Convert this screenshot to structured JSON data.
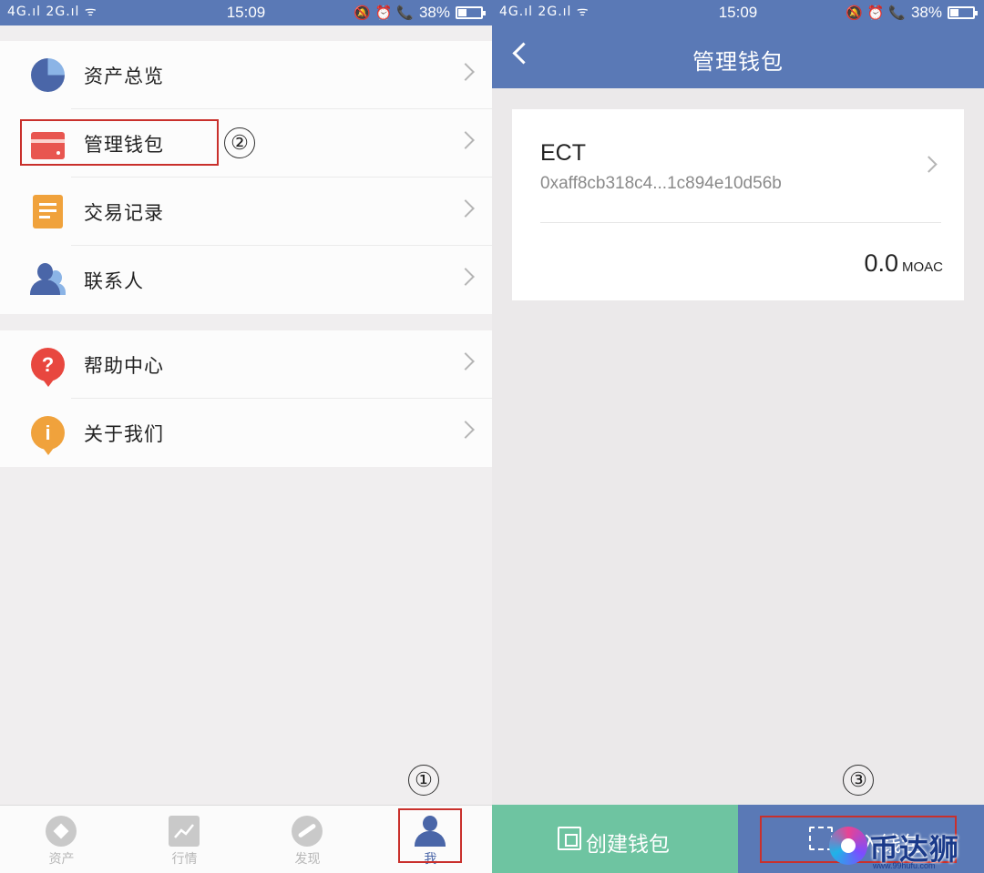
{
  "status": {
    "network": "4G.ıl 2G.ıl ᯤ",
    "time": "15:09",
    "icons": "🔕 ⏰ 📞",
    "battery": "38%"
  },
  "left": {
    "menu_group1": [
      {
        "label": "资产总览",
        "icon": "pie-chart-icon"
      },
      {
        "label": "管理钱包",
        "icon": "wallet-icon"
      },
      {
        "label": "交易记录",
        "icon": "document-icon"
      },
      {
        "label": "联系人",
        "icon": "contacts-icon"
      }
    ],
    "menu_group2": [
      {
        "label": "帮助中心",
        "icon": "help-icon"
      },
      {
        "label": "关于我们",
        "icon": "info-icon"
      }
    ],
    "tabs": [
      {
        "label": "资产",
        "icon": "asset-icon"
      },
      {
        "label": "行情",
        "icon": "market-icon"
      },
      {
        "label": "发现",
        "icon": "discover-icon"
      },
      {
        "label": "我",
        "icon": "profile-icon",
        "active": true
      }
    ],
    "annotations": {
      "step1": "①",
      "step2": "②"
    }
  },
  "right": {
    "title": "管理钱包",
    "wallet": {
      "name": "ECT",
      "address": "0xaff8cb318c4...1c894e10d56b",
      "balance": "0.0",
      "unit": "MOAC"
    },
    "buttons": {
      "create": "创建钱包",
      "import": "导入钱包"
    },
    "annotations": {
      "step3": "③"
    }
  },
  "watermark": {
    "text": "币达狮子",
    "url": "www.99hufu.com"
  },
  "colors": {
    "primary": "#5a79b6",
    "green": "#6ec4a1",
    "annotation": "#c9302c"
  }
}
